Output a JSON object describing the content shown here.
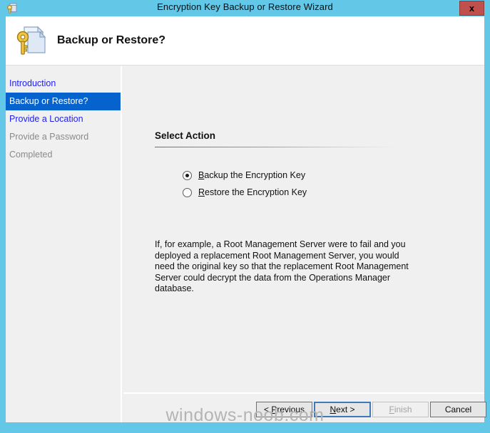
{
  "window": {
    "title": "Encryption Key Backup or Restore Wizard",
    "title_icon": "key-document-icon",
    "close_label": "x",
    "frame_color": "#63C7E8",
    "close_button_color": "#C0504D"
  },
  "header": {
    "icon": "key-document-large-icon",
    "title": "Backup or Restore?"
  },
  "sidebar": {
    "items": [
      {
        "label": "Introduction",
        "state": "link"
      },
      {
        "label": "Backup or Restore?",
        "state": "current"
      },
      {
        "label": "Provide a Location",
        "state": "link"
      },
      {
        "label": "Provide a Password",
        "state": "disabled"
      },
      {
        "label": "Completed",
        "state": "disabled"
      }
    ],
    "link_color": "#2020EE",
    "current_background": "#0663CE",
    "disabled_color": "#8A8A8A"
  },
  "content": {
    "section_title": "Select Action",
    "options": [
      {
        "accelerator": "B",
        "rest": "ackup the Encryption Key",
        "full_label": "Backup the Encryption Key",
        "selected": true
      },
      {
        "accelerator": "R",
        "rest": "estore the Encryption Key",
        "full_label": "Restore the Encryption Key",
        "selected": false
      }
    ],
    "description": "If, for example, a Root Management Server were to fail and you deployed a replacement Root Management Server, you would need the original key so that the replacement Root Management Server could decrypt the data from the Operations Manager database."
  },
  "buttons": {
    "previous": {
      "prefix": "< ",
      "accelerator": "P",
      "rest": "revious",
      "full_label": "< Previous",
      "enabled": true
    },
    "next": {
      "accelerator": "N",
      "rest": "ext >",
      "full_label": "Next >",
      "enabled": true,
      "focused": true
    },
    "finish": {
      "accelerator": "F",
      "rest": "inish",
      "full_label": "Finish",
      "enabled": false
    },
    "cancel": {
      "full_label": "Cancel",
      "enabled": true
    }
  },
  "watermark": {
    "text": "windows-noob.com"
  }
}
